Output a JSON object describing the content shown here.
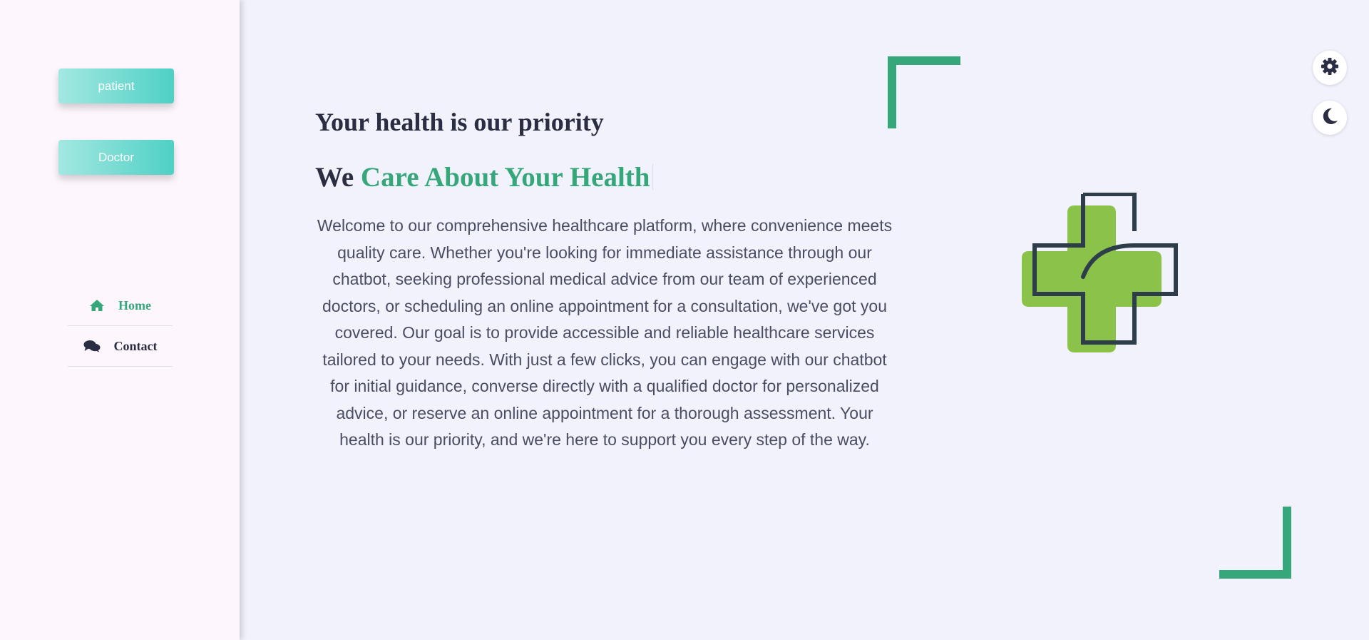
{
  "sidebar": {
    "role_buttons": {
      "patient": "patient",
      "doctor": "Doctor"
    },
    "nav": {
      "home": {
        "label": "Home",
        "icon": "home-icon"
      },
      "contact": {
        "label": "Contact",
        "icon": "comments-icon"
      }
    }
  },
  "hero": {
    "heading": "Your health is our priority",
    "tagline_prefix": "We",
    "tagline_accent": "Care About Your Health",
    "description": "Welcome to our comprehensive healthcare platform, where convenience meets quality care. Whether you're looking for immediate assistance through our chatbot, seeking professional medical advice from our team of experienced doctors, or scheduling an online appointment for a consultation, we've got you covered. Our goal is to provide accessible and reliable healthcare services tailored to your needs. With just a few clicks, you can engage with our chatbot for initial guidance, converse directly with a qualified doctor for personalized advice, or reserve an online appointment for a thorough assessment. Your health is our priority, and we're here to support you every step of the way.",
    "illustration": "medical-cross-icon"
  },
  "toolbar": {
    "settings_icon": "gear-icon",
    "theme_icon": "moon-icon"
  },
  "colors": {
    "accent_green": "#36a77b",
    "dark_text": "#2b2d42",
    "button_gradient_start": "#a3e8e2",
    "button_gradient_end": "#4fd0c4",
    "cross_green": "#8bc34a",
    "cross_outline": "#2d3e4a"
  }
}
